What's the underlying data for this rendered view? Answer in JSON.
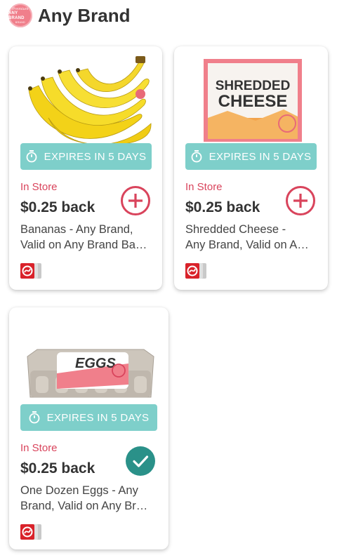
{
  "header": {
    "logo_line1": "Premium",
    "logo_line2": "ANY BRAND",
    "logo_line3": "BRAND",
    "title": "Any Brand"
  },
  "colors": {
    "accent_red": "#d9445c",
    "expires_teal": "#7ecfca",
    "clipped_teal": "#2a9189"
  },
  "offers": [
    {
      "image": "bananas",
      "expires": "EXPIRES IN 5 DAYS",
      "channel": "In Store",
      "price": "$0.25 back",
      "description_line1": "Bananas - Any Brand,",
      "description_line2": "Valid on Any Brand Ba…",
      "action": "add-icon",
      "package_label": ""
    },
    {
      "image": "shredded-cheese",
      "expires": "EXPIRES IN 5 DAYS",
      "channel": "In Store",
      "price": "$0.25 back",
      "description_line1": "Shredded Cheese -",
      "description_line2": "Any Brand, Valid on A…",
      "action": "add-icon",
      "package_label": "SHREDDED CHEESE"
    },
    {
      "image": "eggs",
      "expires": "EXPIRES IN 5 DAYS",
      "channel": "In Store",
      "price": "$0.25 back",
      "description_line1": "One Dozen Eggs - Any",
      "description_line2": "Brand, Valid on Any Br…",
      "action": "checkmark-icon",
      "package_label": "EGGS"
    }
  ]
}
